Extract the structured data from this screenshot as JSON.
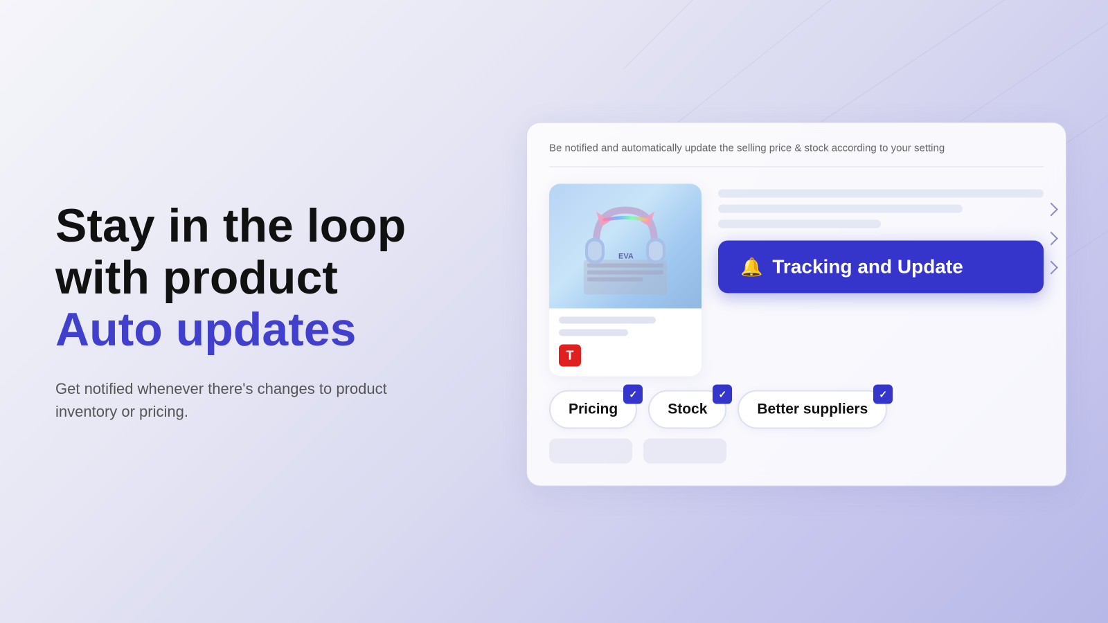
{
  "background": {
    "color_start": "#f5f5fa",
    "color_end": "#b8b8e8"
  },
  "left": {
    "headline_line1": "Stay in the loop",
    "headline_line2": "with product",
    "headline_accent": "Auto updates",
    "subtext": "Get notified whenever there's changes to product inventory or pricing."
  },
  "right": {
    "card_description": "Be notified and automatically update the selling price & stock according to your setting",
    "tracking_button": {
      "label": "Tracking and Update",
      "icon": "bell-icon"
    },
    "chips": [
      {
        "label": "Pricing",
        "checked": true
      },
      {
        "label": "Stock",
        "checked": true
      },
      {
        "label": "Better suppliers",
        "checked": true
      }
    ],
    "product_logo": "T"
  }
}
